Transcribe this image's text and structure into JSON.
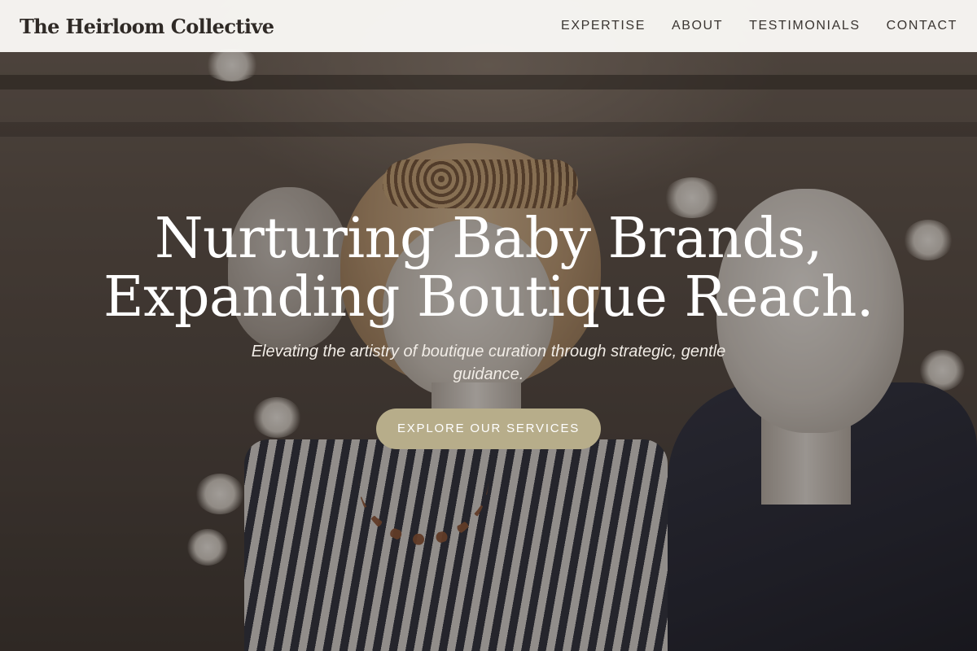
{
  "header": {
    "brand": "The Heirloom Collective",
    "nav": [
      {
        "label": "EXPERTISE"
      },
      {
        "label": "ABOUT"
      },
      {
        "label": "TESTIMONIALS"
      },
      {
        "label": "CONTACT"
      }
    ]
  },
  "hero": {
    "headline_line1": "Nurturing Baby Brands,",
    "headline_line2": "Expanding Boutique Reach.",
    "subhead": "Elevating the artistry of boutique curation through strategic, gentle guidance.",
    "cta_label": "EXPLORE OUR SERVICES"
  },
  "colors": {
    "header_bg": "#faf9f6",
    "brand_text": "#2f2a26",
    "cta_bg": "#b7ad8a",
    "headline_text": "#ffffff"
  }
}
